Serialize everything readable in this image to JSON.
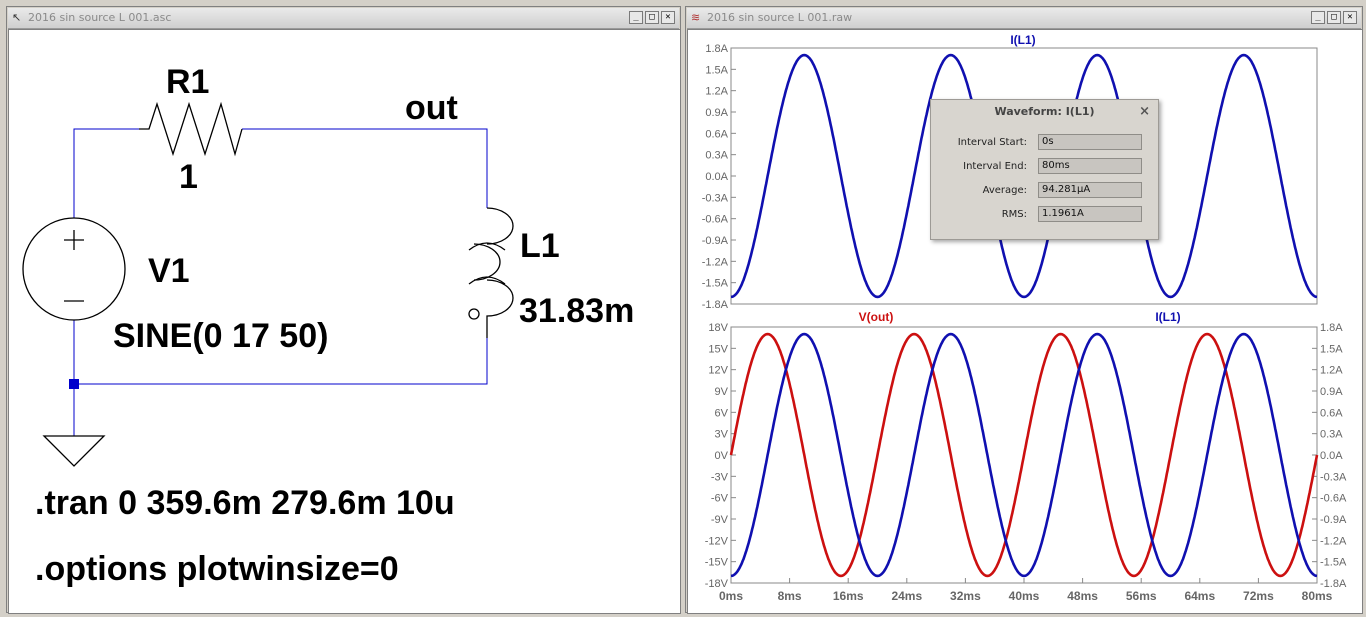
{
  "schematic": {
    "title": "2016 sin source L 001.asc",
    "r1_name": "R1",
    "r1_value": "1",
    "net_label": "out",
    "l1_name": "L1",
    "l1_value": "31.83m",
    "v1_name": "V1",
    "v1_value": "SINE(0 17 50)",
    "directive_tran": ".tran 0 359.6m 279.6m 10u",
    "directive_options": ".options plotwinsize=0"
  },
  "waveform_window": {
    "title": "2016 sin source L 001.raw",
    "top_pane": {
      "trace_label": "I(L1)",
      "y_ticks": [
        "1.8A",
        "1.5A",
        "1.2A",
        "0.9A",
        "0.6A",
        "0.3A",
        "0.0A",
        "-0.3A",
        "-0.6A",
        "-0.9A",
        "-1.2A",
        "-1.5A",
        "-1.8A"
      ]
    },
    "bottom_pane": {
      "trace_label_left": "V(out)",
      "trace_label_right": "I(L1)",
      "y_ticks_left": [
        "18V",
        "15V",
        "12V",
        "9V",
        "6V",
        "3V",
        "0V",
        "-3V",
        "-6V",
        "-9V",
        "-12V",
        "-15V",
        "-18V"
      ],
      "y_ticks_right": [
        "1.8A",
        "1.5A",
        "1.2A",
        "0.9A",
        "0.6A",
        "0.3A",
        "0.0A",
        "-0.3A",
        "-0.6A",
        "-0.9A",
        "-1.2A",
        "-1.5A",
        "-1.8A"
      ],
      "x_ticks": [
        "0ms",
        "8ms",
        "16ms",
        "24ms",
        "32ms",
        "40ms",
        "48ms",
        "56ms",
        "64ms",
        "72ms",
        "80ms"
      ]
    }
  },
  "dialog": {
    "title": "Waveform: I(L1)",
    "close": "×",
    "rows": [
      {
        "label": "Interval Start:",
        "value": "0s"
      },
      {
        "label": "Interval End:",
        "value": "80ms"
      },
      {
        "label": "Average:",
        "value": "94.281µA"
      },
      {
        "label": "RMS:",
        "value": "1.1961A"
      }
    ]
  },
  "chart_data": [
    {
      "type": "line",
      "title": "I(L1)",
      "x_range_ms": [
        0,
        80
      ],
      "ylim": [
        -1.8,
        1.8
      ],
      "series": [
        {
          "name": "I(L1)",
          "function": "-1.7*cos(2*pi*50*t)",
          "amplitude": 1.7,
          "frequency_hz": 50,
          "color": "#1010b0"
        }
      ]
    },
    {
      "type": "line",
      "x_range_ms": [
        0,
        80
      ],
      "ylim_left": [
        -18,
        18
      ],
      "ylim_right": [
        -1.8,
        1.8
      ],
      "series": [
        {
          "name": "V(out)",
          "function": "17*sin(2*pi*50*t)",
          "amplitude": 17,
          "frequency_hz": 50,
          "color": "#cc1010",
          "axis": "left"
        },
        {
          "name": "I(L1)",
          "function": "-1.7*cos(2*pi*50*t)",
          "amplitude": 1.7,
          "frequency_hz": 50,
          "color": "#1010b0",
          "axis": "right"
        }
      ]
    }
  ]
}
